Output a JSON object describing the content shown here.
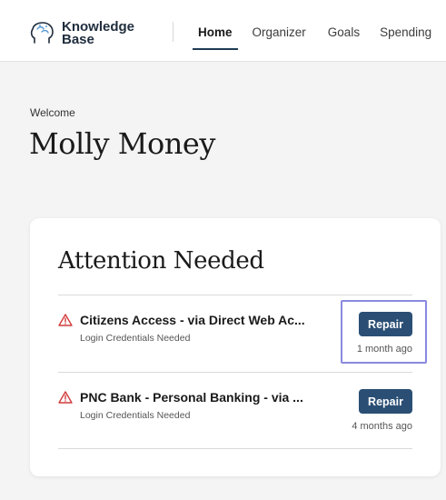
{
  "header": {
    "logo_line1": "Knowledge",
    "logo_line2": "Base",
    "nav": [
      "Home",
      "Organizer",
      "Goals",
      "Spending"
    ]
  },
  "welcome": {
    "label": "Welcome",
    "name": "Molly Money"
  },
  "attention": {
    "title": "Attention Needed",
    "items": [
      {
        "title": "Citizens Access - via Direct Web Ac...",
        "subtitle": "Login Credentials Needed",
        "action": "Repair",
        "time": "1 month ago"
      },
      {
        "title": "PNC Bank - Personal Banking - via ...",
        "subtitle": "Login Credentials Needed",
        "action": "Repair",
        "time": "4 months ago"
      }
    ]
  },
  "colors": {
    "accent": "#2b4f74",
    "warning": "#d23b3b",
    "highlight": "#8a8ae0"
  }
}
